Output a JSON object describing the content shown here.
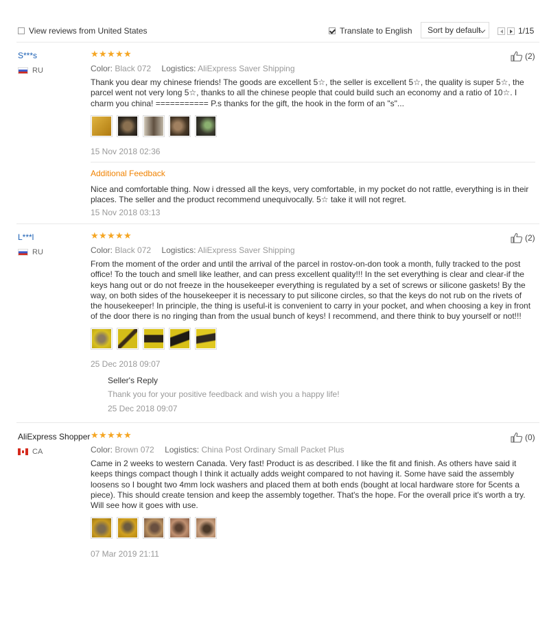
{
  "toolbar": {
    "view_us_label": "View reviews from United States",
    "view_us_checked": false,
    "translate_label": "Translate to English",
    "translate_checked": true,
    "sort_label": "Sort by default",
    "page_indicator": "1/15"
  },
  "reviews": [
    {
      "user": "S***s",
      "country": "RU",
      "rating": 5,
      "color_label": "Color:",
      "color_value": "Black 072",
      "logistics_label": "Logistics:",
      "logistics_value": "AliExpress Saver Shipping",
      "text": "Thank you dear my chinese friends! The goods are excellent 5☆, the seller is excellent 5☆, the quality is super 5☆, the parcel went not very long 5☆, thanks to all the chinese people that could build such an economy and a ratio of 10☆. I charm you china! =========== P.s thanks for the gift, the hook in the form of an \"s\"...",
      "date": "15 Nov 2018 02:36",
      "likes": "(2)",
      "additional_label": "Additional Feedback",
      "additional_text": "Nice and comfortable thing. Now i dressed all the keys, very comfortable, in my pocket do not rattle, everything is in their places. The seller and the product recommend unequivocally. 5☆ take it will not regret.",
      "additional_date": "15 Nov 2018 03:13"
    },
    {
      "user": "L***l",
      "country": "RU",
      "rating": 5,
      "color_label": "Color:",
      "color_value": "Black 072",
      "logistics_label": "Logistics:",
      "logistics_value": "AliExpress Saver Shipping",
      "text": "From the moment of the order and until the arrival of the parcel in rostov-on-don took a month, fully tracked to the post office! To the touch and smell like leather, and can press excellent quality!!! In the set everything is clear and clear-if the keys hang out or do not freeze in the housekeeper everything is regulated by a set of screws or silicone gaskets! By the way, on both sides of the housekeeper it is necessary to put silicone circles, so that the keys do not rub on the rivets of the housekeeper! In principle, the thing is useful-it is convenient to carry in your pocket, and when choosing a key in front of the door there is no ringing than from the usual bunch of keys! I recommend, and there think to buy yourself or not!!!",
      "date": "25 Dec 2018 09:07",
      "likes": "(2)",
      "reply_label": "Seller's Reply",
      "reply_text": "Thank you for your positive feedback and wish you a happy life!",
      "reply_date": "25 Dec 2018 09:07"
    },
    {
      "user": "AliExpress Shopper",
      "country": "CA",
      "rating": 5,
      "color_label": "Color:",
      "color_value": "Brown 072",
      "logistics_label": "Logistics:",
      "logistics_value": "China Post Ordinary Small Packet Plus",
      "text": "Came in 2 weeks to western Canada. Very fast! Product is as described. I like the fit and finish. As others have said it keeps things compact though I think it actually adds weight compared to not having it. Some have said the assembly loosens so I bought two 4mm lock washers and placed them at both ends (bought at local hardware store for 5cents a piece). This should create tension and keep the assembly together. That's the hope. For the overall price it's worth a try. Will see how it goes with use.",
      "date": "07 Mar 2019 21:11",
      "likes": "(0)"
    }
  ],
  "icons": {
    "star": "star-icon",
    "like": "thumbs-up-icon",
    "flag_ru": "russia-flag-icon",
    "flag_ca": "canada-flag-icon"
  },
  "colors": {
    "username": "#1a5fb4",
    "star": "#f5a623",
    "additional_feedback": "#f08200",
    "muted": "#999999"
  }
}
